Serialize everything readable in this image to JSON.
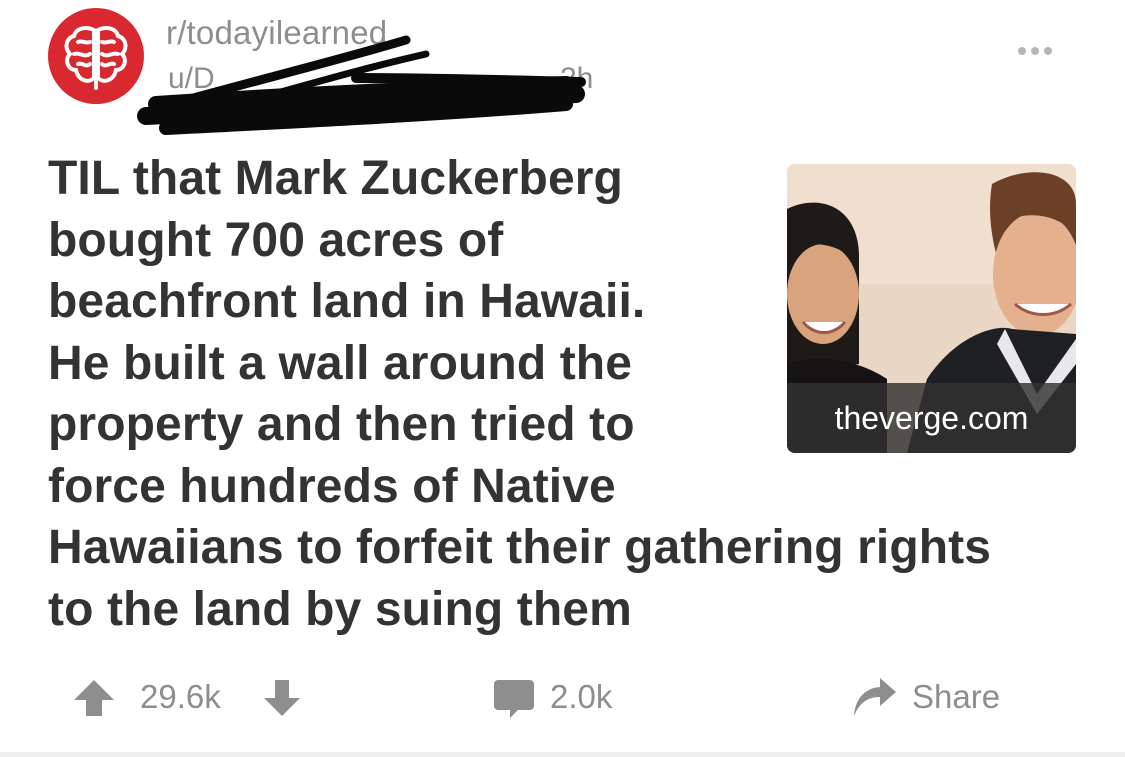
{
  "header": {
    "subreddit": "r/todayilearned",
    "user_prefix": "u/D",
    "time_ago": "2h"
  },
  "post": {
    "title_lines": [
      "TIL that Mark Zuckerberg",
      "bought 700 acres of",
      "beachfront land in Hawaii.",
      "He built a wall around the",
      "property and then tried to",
      "force hundreds of Native",
      "Hawaiians to forfeit their gathering rights",
      "to the land by suing them"
    ],
    "thumbnail": {
      "domain": "theverge.com"
    }
  },
  "actions": {
    "score": "29.6k",
    "comments": "2.0k",
    "share_label": "Share"
  },
  "icons": {
    "avatar": "brain-icon",
    "more": "more-options-icon",
    "upvote": "upvote-arrow-icon",
    "downvote": "downvote-arrow-icon",
    "comment": "comment-bubble-icon",
    "share": "share-arrow-icon"
  },
  "colors": {
    "avatar_red": "#d9282f",
    "meta_gray": "#8e8e8e",
    "title": "#333333",
    "icon_gray": "#8e8e8e"
  }
}
